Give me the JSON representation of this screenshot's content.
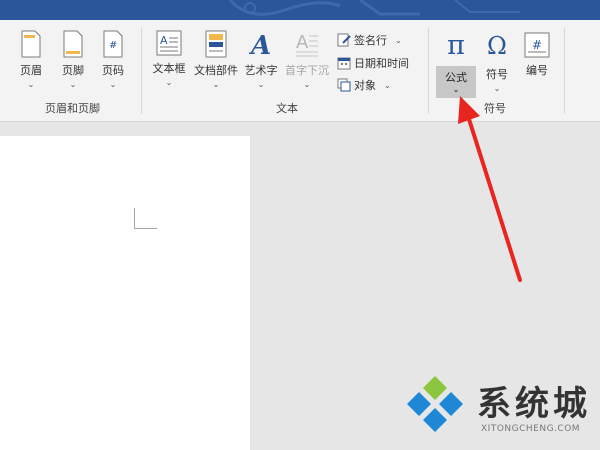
{
  "ribbon": {
    "header_footer_group": {
      "label": "页眉和页脚",
      "header_label": "页眉",
      "footer_label": "页脚",
      "page_number_label": "页码"
    },
    "text_group": {
      "label": "文本",
      "textbox_label": "文本框",
      "quickparts_label": "文档部件",
      "wordart_label": "艺术字",
      "dropcap_label": "首字下沉",
      "signature_label": "签名行",
      "datetime_label": "日期和时间",
      "object_label": "对象"
    },
    "symbols_group": {
      "label": "符号",
      "equation_label": "公式",
      "symbol_label": "符号",
      "number_label": "编号"
    }
  },
  "watermark": {
    "text": "系统城",
    "url": "XITONGCHENG.COM"
  },
  "colors": {
    "title_bar": "#2b579a",
    "ribbon_bg": "#f3f3f3",
    "accent_blue": "#2b579a",
    "arrow_red": "#e8261f",
    "workspace": "#e6e6e6"
  }
}
